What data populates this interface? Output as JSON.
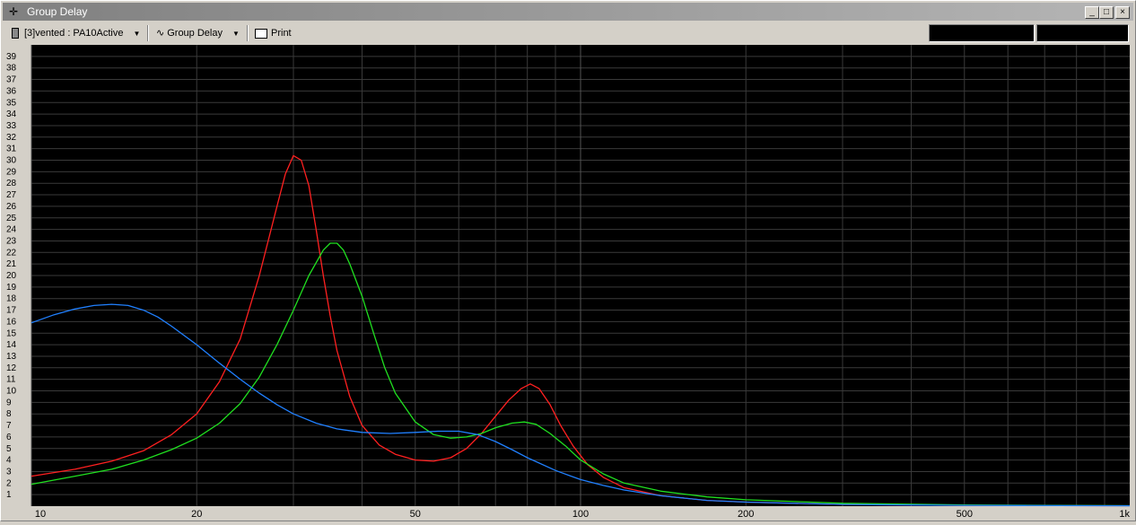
{
  "window": {
    "title": "Group Delay",
    "title_icon": "crosshair-icon",
    "controls": [
      "minimize-icon",
      "maximize-icon",
      "close-icon"
    ]
  },
  "toolbar": {
    "project_label": "[3]vented : PA10Active",
    "project_icon": "speaker-icon",
    "view_label": "Group Delay",
    "view_icon": "wave-icon",
    "print_label": "Print",
    "print_icon": "printer-icon",
    "readout_left": "",
    "readout_right": ""
  },
  "colors": {
    "plot_bg": "#000000",
    "grid": "#3a3a3a",
    "tick_text": "#ffffff",
    "axis_strip": "#d4d0c8"
  },
  "chart_data": {
    "type": "line",
    "title": "",
    "xlabel": "",
    "ylabel": "",
    "xscale": "log",
    "xlim": [
      10,
      1000
    ],
    "ylim": [
      0,
      40
    ],
    "grid": true,
    "x_tick_labels": [
      {
        "value": 10,
        "label": "10"
      },
      {
        "value": 20,
        "label": "20"
      },
      {
        "value": 50,
        "label": "50"
      },
      {
        "value": 100,
        "label": "100"
      },
      {
        "value": 200,
        "label": "200"
      },
      {
        "value": 500,
        "label": "500"
      },
      {
        "value": 1000,
        "label": "1k"
      }
    ],
    "y_ticks": [
      1,
      2,
      3,
      4,
      5,
      6,
      7,
      8,
      9,
      10,
      11,
      12,
      13,
      14,
      15,
      16,
      17,
      18,
      19,
      20,
      21,
      22,
      23,
      24,
      25,
      26,
      27,
      28,
      29,
      30,
      31,
      32,
      33,
      34,
      35,
      36,
      37,
      38,
      39
    ],
    "series": [
      {
        "color": "#ff2020",
        "points": [
          [
            10,
            2.6
          ],
          [
            12,
            3.2
          ],
          [
            14,
            3.9
          ],
          [
            16,
            4.8
          ],
          [
            18,
            6.2
          ],
          [
            20,
            8.0
          ],
          [
            22,
            10.8
          ],
          [
            24,
            14.5
          ],
          [
            26,
            20
          ],
          [
            28,
            26
          ],
          [
            29,
            28.8
          ],
          [
            30,
            30.4
          ],
          [
            31,
            30.0
          ],
          [
            32,
            27.8
          ],
          [
            33,
            24
          ],
          [
            34,
            20
          ],
          [
            35,
            16.5
          ],
          [
            36,
            13.5
          ],
          [
            38,
            9.5
          ],
          [
            40,
            7.0
          ],
          [
            43,
            5.3
          ],
          [
            46,
            4.5
          ],
          [
            50,
            4.0
          ],
          [
            54,
            3.9
          ],
          [
            58,
            4.2
          ],
          [
            62,
            5.0
          ],
          [
            66,
            6.3
          ],
          [
            70,
            7.8
          ],
          [
            74,
            9.2
          ],
          [
            78,
            10.2
          ],
          [
            81,
            10.6
          ],
          [
            84,
            10.2
          ],
          [
            88,
            8.8
          ],
          [
            92,
            7.0
          ],
          [
            97,
            5.2
          ],
          [
            103,
            3.6
          ],
          [
            110,
            2.5
          ],
          [
            120,
            1.6
          ],
          [
            140,
            0.9
          ],
          [
            170,
            0.5
          ],
          [
            200,
            0.35
          ],
          [
            300,
            0.15
          ],
          [
            500,
            0.07
          ],
          [
            1000,
            0.03
          ]
        ]
      },
      {
        "color": "#20e020",
        "points": [
          [
            10,
            1.9
          ],
          [
            12,
            2.6
          ],
          [
            14,
            3.2
          ],
          [
            16,
            4.0
          ],
          [
            18,
            4.9
          ],
          [
            20,
            5.9
          ],
          [
            22,
            7.2
          ],
          [
            24,
            8.9
          ],
          [
            26,
            11.2
          ],
          [
            28,
            14.0
          ],
          [
            30,
            17.0
          ],
          [
            32,
            20.0
          ],
          [
            34,
            22.2
          ],
          [
            35,
            22.8
          ],
          [
            36,
            22.8
          ],
          [
            37,
            22.2
          ],
          [
            38,
            21.0
          ],
          [
            40,
            18.2
          ],
          [
            42,
            15.0
          ],
          [
            44,
            12.0
          ],
          [
            46,
            9.8
          ],
          [
            50,
            7.3
          ],
          [
            54,
            6.2
          ],
          [
            58,
            5.9
          ],
          [
            62,
            6.0
          ],
          [
            66,
            6.3
          ],
          [
            70,
            6.8
          ],
          [
            75,
            7.2
          ],
          [
            79,
            7.3
          ],
          [
            83,
            7.1
          ],
          [
            88,
            6.3
          ],
          [
            94,
            5.2
          ],
          [
            100,
            4.0
          ],
          [
            110,
            2.8
          ],
          [
            120,
            2.0
          ],
          [
            140,
            1.3
          ],
          [
            170,
            0.8
          ],
          [
            200,
            0.55
          ],
          [
            300,
            0.25
          ],
          [
            500,
            0.1
          ],
          [
            1000,
            0.04
          ]
        ]
      },
      {
        "color": "#2080ff",
        "points": [
          [
            10,
            15.9
          ],
          [
            11,
            16.6
          ],
          [
            12,
            17.1
          ],
          [
            13,
            17.4
          ],
          [
            14,
            17.5
          ],
          [
            15,
            17.4
          ],
          [
            16,
            17.0
          ],
          [
            17,
            16.4
          ],
          [
            18,
            15.6
          ],
          [
            20,
            14.0
          ],
          [
            22,
            12.4
          ],
          [
            24,
            11.0
          ],
          [
            26,
            9.8
          ],
          [
            28,
            8.8
          ],
          [
            30,
            8.0
          ],
          [
            33,
            7.2
          ],
          [
            36,
            6.7
          ],
          [
            40,
            6.4
          ],
          [
            45,
            6.3
          ],
          [
            50,
            6.4
          ],
          [
            55,
            6.5
          ],
          [
            60,
            6.5
          ],
          [
            65,
            6.2
          ],
          [
            70,
            5.6
          ],
          [
            75,
            4.9
          ],
          [
            80,
            4.2
          ],
          [
            90,
            3.1
          ],
          [
            100,
            2.3
          ],
          [
            110,
            1.8
          ],
          [
            120,
            1.4
          ],
          [
            140,
            0.9
          ],
          [
            170,
            0.5
          ],
          [
            200,
            0.35
          ],
          [
            300,
            0.15
          ],
          [
            500,
            0.07
          ],
          [
            1000,
            0.03
          ]
        ]
      }
    ]
  }
}
